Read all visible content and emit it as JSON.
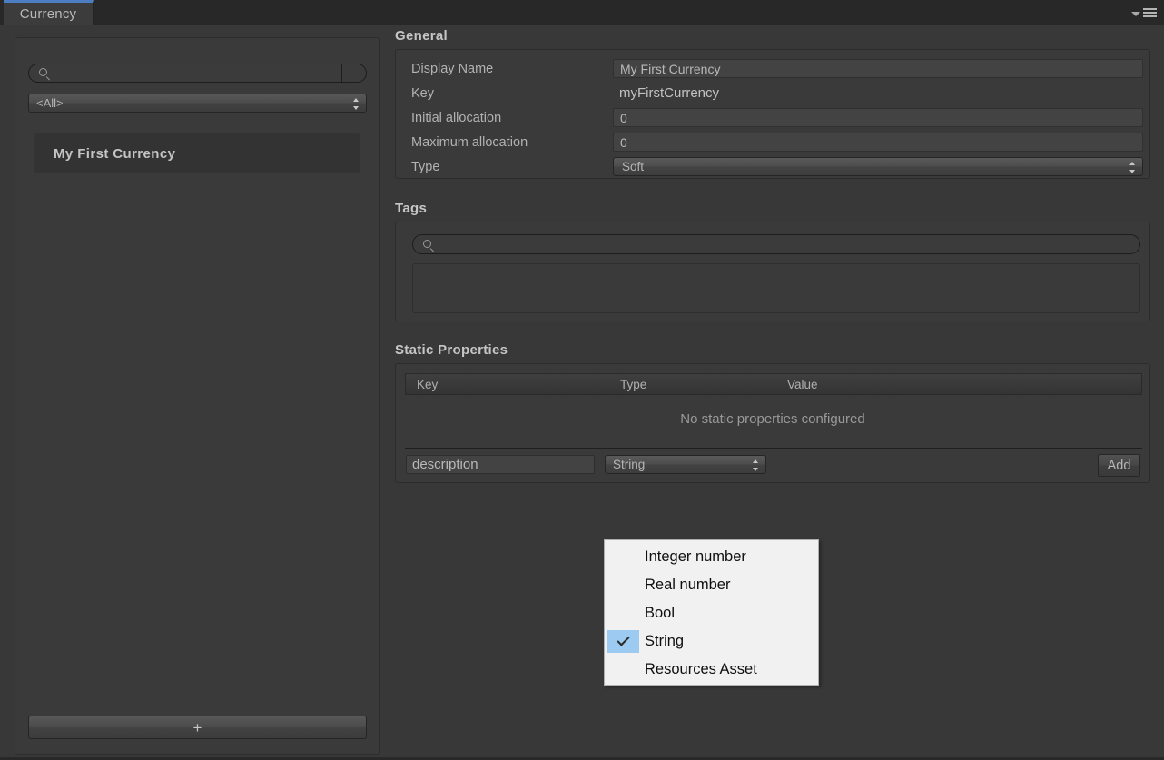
{
  "window": {
    "tab_label": "Currency",
    "menu_icon": "hamburger-menu-icon",
    "caret_icon": "chevron-down-icon"
  },
  "left_panel": {
    "search_placeholder": "",
    "search_value": "",
    "search_icon": "search-icon",
    "filter_dropdown_value": "<All>",
    "items": [
      {
        "label": "My First Currency",
        "selected": true
      }
    ],
    "add_button_label": "+"
  },
  "general": {
    "title": "General",
    "fields": {
      "display_name_label": "Display Name",
      "display_name_value": "My First Currency",
      "key_label": "Key",
      "key_value": "myFirstCurrency",
      "initial_allocation_label": "Initial allocation",
      "initial_allocation_value": "0",
      "maximum_allocation_label": "Maximum allocation",
      "maximum_allocation_value": "0",
      "type_label": "Type",
      "type_value": "Soft"
    }
  },
  "tags": {
    "title": "Tags",
    "search_value": "",
    "search_icon": "search-icon",
    "list_items": []
  },
  "static_properties": {
    "title": "Static Properties",
    "columns": [
      "Key",
      "Type",
      "Value"
    ],
    "rows": [],
    "empty_message": "No static properties configured",
    "new_key_value": "description",
    "new_type_value": "String",
    "add_button_label": "Add"
  },
  "type_dropdown_popup": {
    "options": [
      {
        "label": "Integer number",
        "checked": false
      },
      {
        "label": "Real number",
        "checked": false
      },
      {
        "label": "Bool",
        "checked": false
      },
      {
        "label": "String",
        "checked": true
      },
      {
        "label": "Resources Asset",
        "checked": false
      }
    ],
    "highlight_color": "#9ccaf0",
    "background_color": "#f1f1f1"
  },
  "colors": {
    "window_bg": "#383838",
    "chrome_bg": "#282828",
    "tab_accent": "#4d7ec4",
    "panel_bg": "#3a3a3a",
    "text": "#b8b8b8"
  }
}
